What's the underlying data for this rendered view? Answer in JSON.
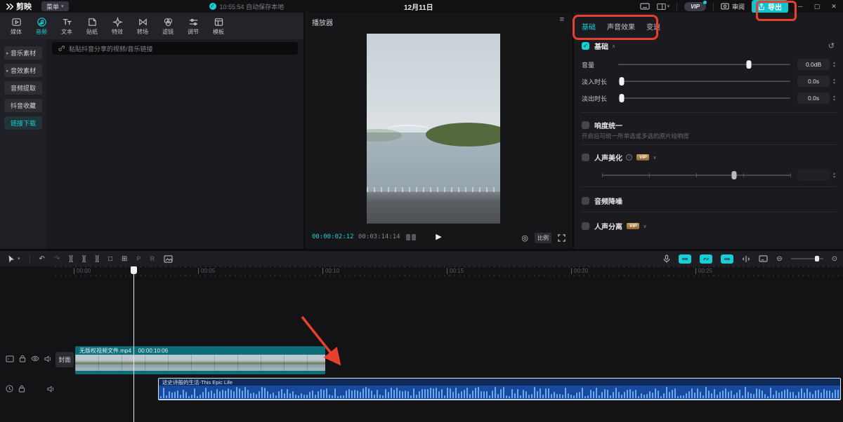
{
  "titlebar": {
    "logo_text": "剪映",
    "menu_label": "菜单",
    "autosave_text": "10:55:54 自动保存本地",
    "date": "12月11日",
    "vip_label": "VIP",
    "review_label": "审阅",
    "export_label": "导出",
    "minimize": "─",
    "maximize": "▢",
    "close": "✕"
  },
  "toolbar": {
    "items": [
      {
        "label": "媒体"
      },
      {
        "label": "音频",
        "active": true
      },
      {
        "label": "文本"
      },
      {
        "label": "贴纸"
      },
      {
        "label": "特效"
      },
      {
        "label": "转场"
      },
      {
        "label": "滤镜"
      },
      {
        "label": "调节"
      },
      {
        "label": "模板"
      }
    ]
  },
  "sidebar": {
    "items": [
      {
        "label": "音乐素材",
        "expandable": true
      },
      {
        "label": "音效素材",
        "expandable": true
      },
      {
        "label": "音频提取"
      },
      {
        "label": "抖音收藏"
      },
      {
        "label": "链接下载",
        "active": true
      }
    ]
  },
  "search": {
    "placeholder": "粘贴抖音分享的视频/音乐链接"
  },
  "player": {
    "title": "播放器",
    "current_time": "00:00:02:12",
    "total_time": "00:03:14:14",
    "ratio_label": "比例"
  },
  "inspector": {
    "tabs": [
      {
        "label": "基础",
        "active": true
      },
      {
        "label": "声音效果"
      },
      {
        "label": "变速"
      }
    ],
    "basic_section_label": "基础",
    "volume": {
      "label": "音量",
      "value": "0.0dB"
    },
    "fade_in": {
      "label": "淡入时长",
      "value": "0.0s"
    },
    "fade_out": {
      "label": "淡出时长",
      "value": "0.0s"
    },
    "loudness": {
      "label": "响度统一",
      "description": "开启后可统一所单选或多选的原片段响度"
    },
    "voice_beautify": {
      "label": "人声美化",
      "vip": "VIP"
    },
    "denoise": {
      "label": "音频降噪"
    },
    "vocal_separation": {
      "label": "人声分离",
      "vip": "VIP"
    }
  },
  "timeline": {
    "ruler_labels": [
      "00:00",
      "00:05",
      "00:10",
      "00:15",
      "00:20",
      "00:25"
    ],
    "cover_label": "封面",
    "video_clip": {
      "name": "无版权视频文件.mp4",
      "duration": "00:00:10:06"
    },
    "audio_clip": {
      "name": "这史诗般的生活-This Epic Life"
    }
  },
  "icons": {
    "dropdown": "▾",
    "check": "✓",
    "menu_lines": "≡",
    "play": "▶",
    "snapshot": "◎",
    "undo": "↶",
    "redo": "↷",
    "split": "][",
    "freeze": "□",
    "mirror_letter": "P",
    "rotate_letter": "R",
    "crop": "⊞",
    "zoom_out": "⊖",
    "zoom_fit": "⊙",
    "reset": "↺",
    "caret_up": "∧",
    "caret_down": "∨",
    "info": "i",
    "triangle_right": "▸",
    "stepper_up": "▲",
    "stepper_down": "▼"
  },
  "colors": {
    "accent": "#17cfd4",
    "export_button": "#10c3ce",
    "annotation_red": "#e8402e",
    "video_clip_teal": "#0d6e7a",
    "audio_clip_blue": "#174a9e"
  }
}
